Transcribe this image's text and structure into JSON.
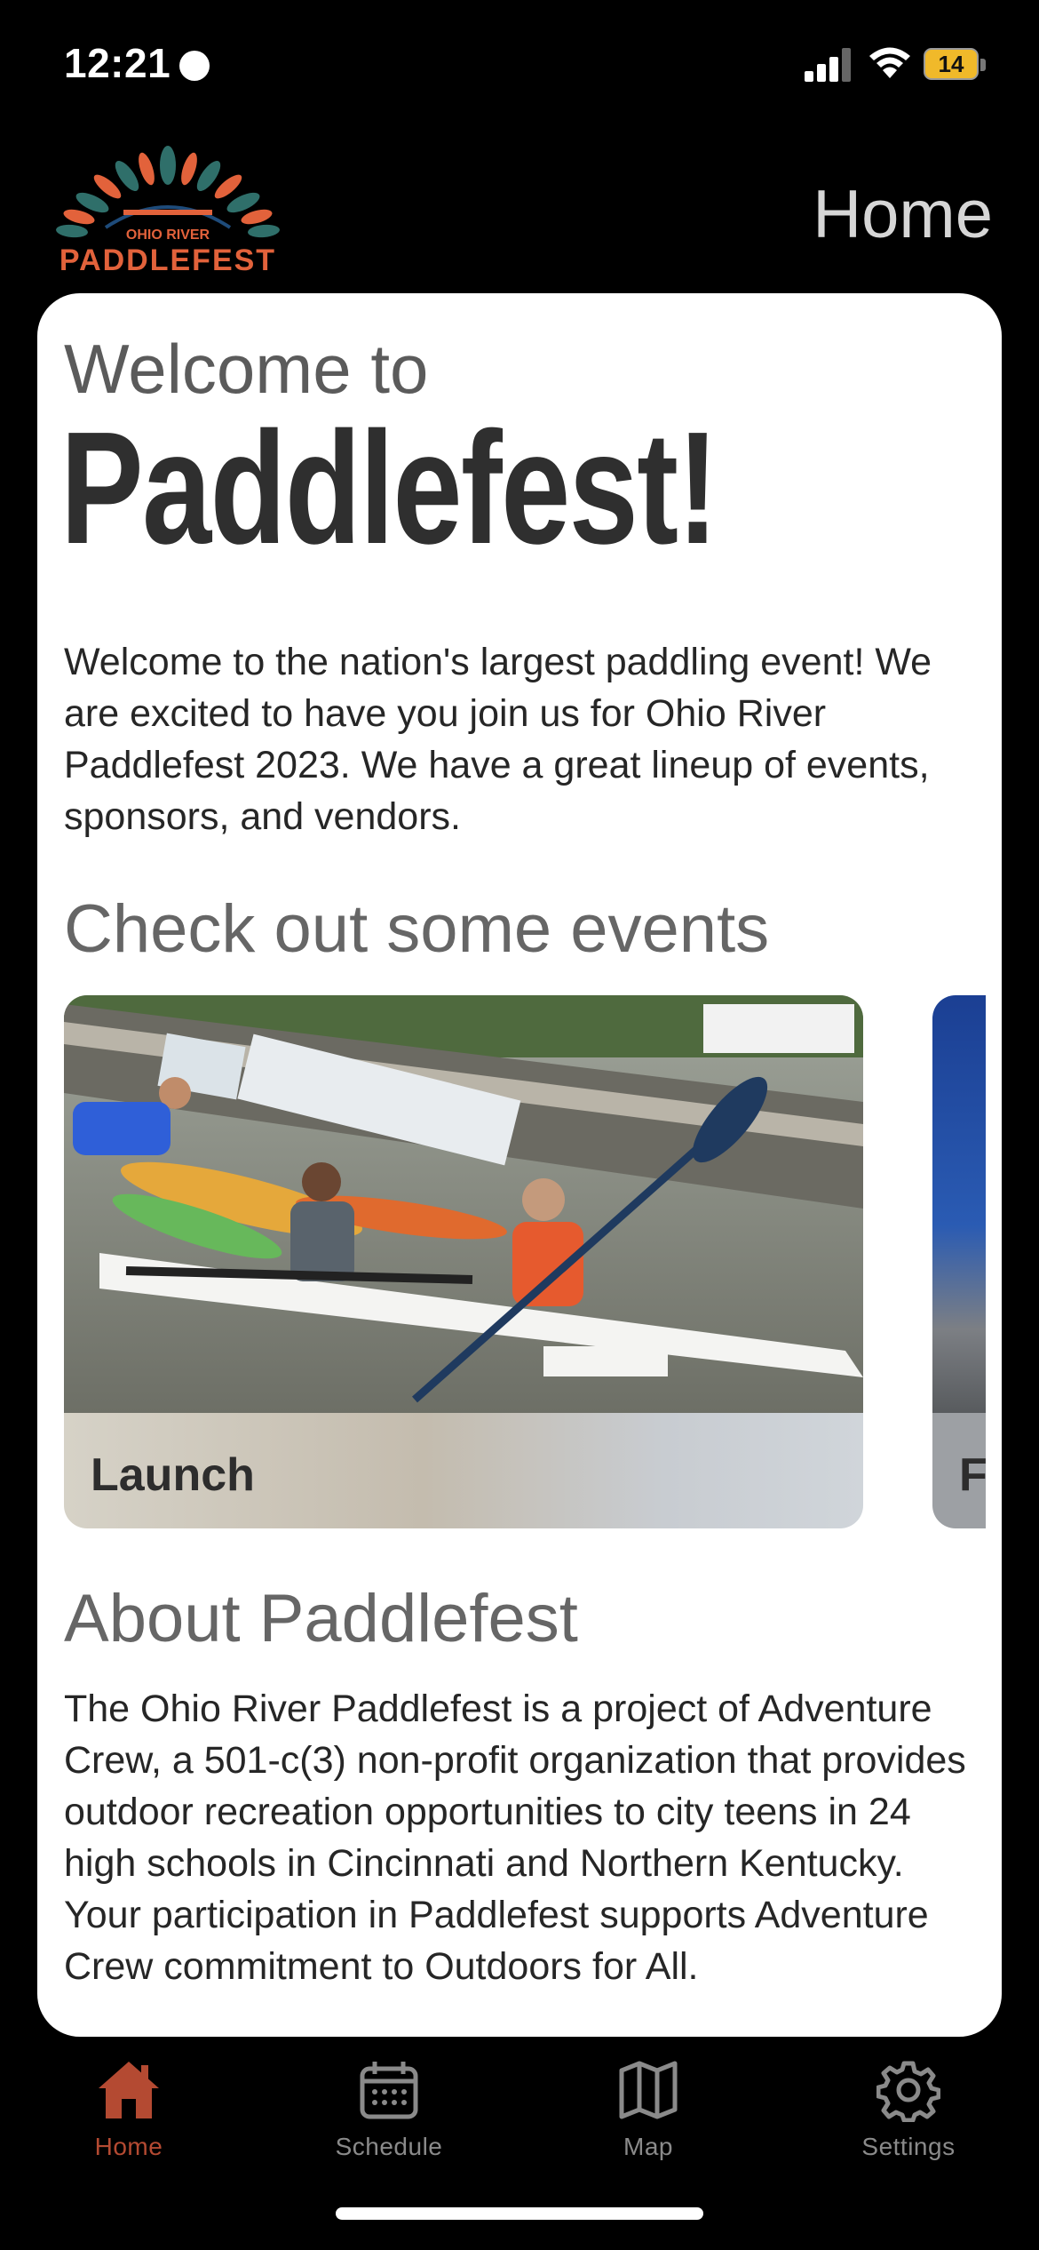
{
  "status_bar": {
    "time": "12:21",
    "battery": "14"
  },
  "header": {
    "title": "Home",
    "logo_text": "PADDLEFEST",
    "logo_subtext": "OHIO RIVER"
  },
  "welcome": {
    "line1": "Welcome to",
    "title": "Paddlefest!"
  },
  "intro": "Welcome to the nation's largest paddling event! We are excited to have you join us for Ohio River Paddlefest 2023. We have a great lineup of events, sponsors, and vendors.",
  "events": {
    "heading": "Check out some events",
    "items": [
      {
        "label": "Launch"
      },
      {
        "label": "F"
      }
    ]
  },
  "about": {
    "heading": "About Paddlefest",
    "body": "The Ohio River Paddlefest is a project of Adventure Crew, a 501-c(3) non-profit organization that provides outdoor recreation opportunities to city teens in 24 high schools in Cincinnati and Northern Kentucky. Your participation in Paddlefest supports Adventure Crew commitment to Outdoors for All."
  },
  "tabs": [
    {
      "label": "Home",
      "icon": "home-icon",
      "active": true
    },
    {
      "label": "Schedule",
      "icon": "calendar-icon",
      "active": false
    },
    {
      "label": "Map",
      "icon": "map-icon",
      "active": false
    },
    {
      "label": "Settings",
      "icon": "gear-icon",
      "active": false
    }
  ],
  "colors": {
    "accent": "#b44a32",
    "inactive": "#8a8a8a",
    "background": "#000000",
    "card": "#ffffff"
  }
}
